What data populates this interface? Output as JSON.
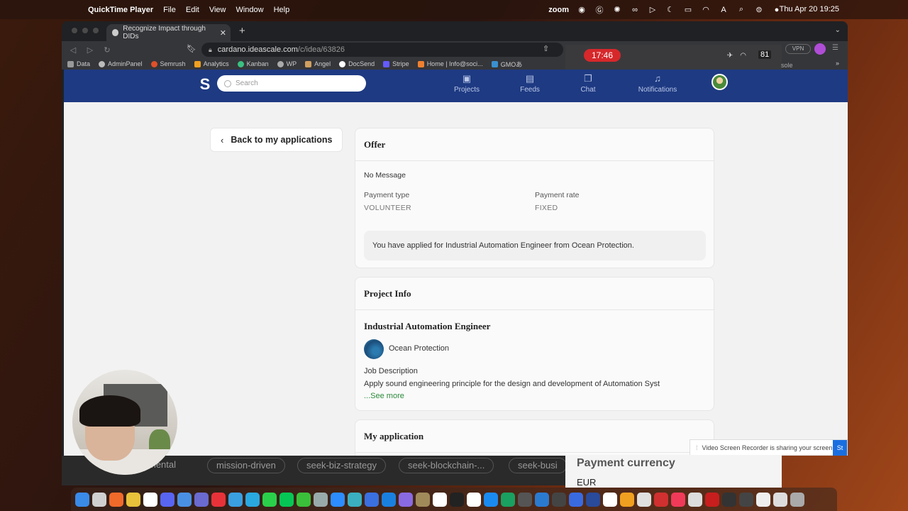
{
  "menubar": {
    "app_name": "QuickTime Player",
    "menus": [
      "File",
      "Edit",
      "View",
      "Window",
      "Help"
    ],
    "zoom_label": "zoom",
    "clock": "Thu Apr 20  19:25"
  },
  "browser": {
    "tab_title": "Recognize Impact through DIDs",
    "url_host": "cardano.ideascale.com",
    "url_path": "/c/idea/63826",
    "bookmarks": [
      "Data",
      "AdminPanel",
      "Semrush",
      "Analytics",
      "Kanban",
      "WP",
      "Angel",
      "DocSend",
      "Stripe",
      "Home | Info@soci...",
      "GMOあ"
    ],
    "bookmark_tail": "sole"
  },
  "zoom_overlay": {
    "timer": "17:46",
    "vpn": "VPN",
    "battery": "81"
  },
  "site": {
    "search_placeholder": "Search",
    "nav": [
      {
        "label": "Projects",
        "icon": "briefcase-icon"
      },
      {
        "label": "Feeds",
        "icon": "feed-icon"
      },
      {
        "label": "Chat",
        "icon": "chat-icon"
      },
      {
        "label": "Notifications",
        "icon": "bell-icon"
      }
    ],
    "back_label": "Back to my applications",
    "offer": {
      "title": "Offer",
      "message": "No Message",
      "payment_type_label": "Payment type",
      "payment_type_value": "VOLUNTEER",
      "payment_rate_label": "Payment rate",
      "payment_rate_value": "FIXED",
      "applied_text": "You have applied for Industrial Automation Engineer from Ocean Protection."
    },
    "project_info": {
      "title": "Project Info",
      "job_title": "Industrial Automation Engineer",
      "org": "Ocean Protection",
      "jd_label": "Job Description",
      "jd_text": "Apply sound engineering principle for the design and development of Automation Syst",
      "see_more": "...See more"
    },
    "my_application": {
      "title": "My application"
    }
  },
  "sharing_bar": {
    "text": "Video Screen Recorder is sharing your screen.",
    "button": "St"
  },
  "overlay_tags": [
    "mental",
    "mission-driven",
    "seek-biz-strategy",
    "seek-blockchain-...",
    "seek-busi"
  ],
  "payment_currency": {
    "title": "Payment currency",
    "value": "EUR"
  }
}
